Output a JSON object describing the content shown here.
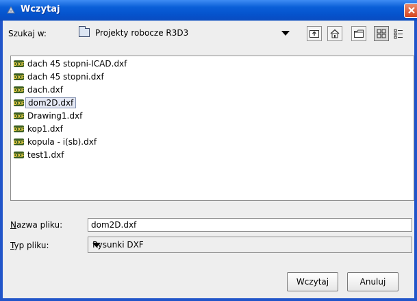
{
  "window": {
    "title": "Wczytaj"
  },
  "lookin": {
    "label": "Szukaj w:",
    "value": "Projekty robocze R3D3"
  },
  "toolbar": {
    "up_icon": "up-folder-icon",
    "home_icon": "home-icon",
    "new_folder_icon": "new-folder-icon",
    "list_view_icon": "list-view-icon",
    "details_view_icon": "details-view-icon"
  },
  "files": [
    {
      "name": "dach 45 stopni-ICAD.dxf",
      "selected": false
    },
    {
      "name": "dach 45 stopni.dxf",
      "selected": false
    },
    {
      "name": "dach.dxf",
      "selected": false
    },
    {
      "name": "dom2D.dxf",
      "selected": true
    },
    {
      "name": "Drawing1.dxf",
      "selected": false
    },
    {
      "name": "kop1.dxf",
      "selected": false
    },
    {
      "name": "kopula - i(sb).dxf",
      "selected": false
    },
    {
      "name": "test1.dxf",
      "selected": false
    }
  ],
  "filename": {
    "label_mnemonic": "N",
    "label_rest": "azwa pliku:",
    "value": "dom2D.dxf"
  },
  "filetype": {
    "label_mnemonic": "T",
    "label_rest": "yp pliku:",
    "value": "Rysunki DXF"
  },
  "buttons": {
    "open": "Wczytaj",
    "cancel": "Anuluj"
  },
  "colors": {
    "title_bar": "#0a5fd8",
    "selection": "#e4e8f4",
    "dialog_bg": "#eeeeee"
  }
}
